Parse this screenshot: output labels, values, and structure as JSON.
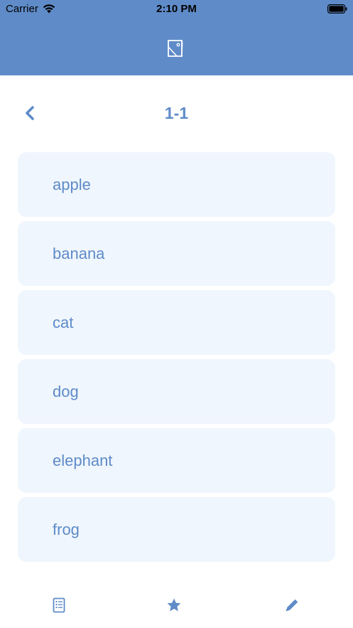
{
  "status_bar": {
    "carrier": "Carrier",
    "time": "2:10 PM",
    "icons": [
      "wifi-icon",
      "battery-icon"
    ]
  },
  "header": {
    "logo_icon": "book-logo-icon",
    "background_color": "#5f8bc8"
  },
  "nav": {
    "back_icon": "chevron-left-icon",
    "title": "1-1"
  },
  "word_list": {
    "items": [
      "apple",
      "banana",
      "cat",
      "dog",
      "elephant",
      "frog"
    ],
    "item_background": "#eff6fd",
    "text_color": "#5f8bc8"
  },
  "tab_bar": {
    "tabs": [
      {
        "icon": "list-icon"
      },
      {
        "icon": "star-icon"
      },
      {
        "icon": "pencil-icon"
      }
    ],
    "icon_color": "#5f8bc8"
  }
}
